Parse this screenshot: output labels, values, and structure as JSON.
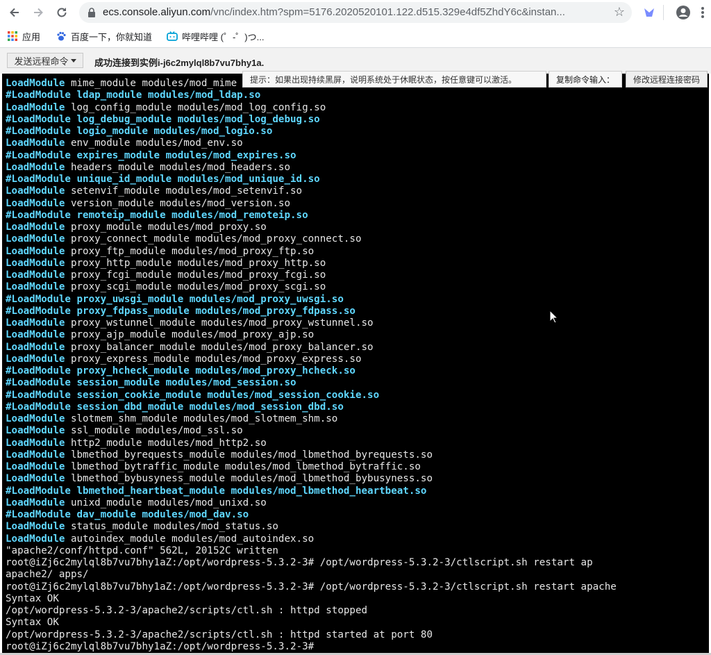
{
  "browser": {
    "url_host": "ecs.console.aliyun.com",
    "url_path": "/vnc/index.htm?spm=5176.2020520101.122.d515.329e4df5ZhdY6c&instan...",
    "bookmarks": [
      {
        "label": "应用",
        "icon": "apps-grid-icon"
      },
      {
        "label": "百度一下，你就知道",
        "icon": "baidu-paw-icon"
      },
      {
        "label": "哔哩哔哩 (゜-゜)つ...",
        "icon": "bilibili-tv-icon"
      }
    ]
  },
  "vnc": {
    "send_command_label": "发送远程命令",
    "status_text": "成功连接到实例i-j6c2mylql8b7vu7bhy1a.",
    "tip_text": "提示：如果出现持续黑屏，说明系统处于休眠状态，按任意键可以激活。",
    "copy_command_label": "复制命令输入：",
    "modify_password_label": "修改远程连接密码"
  },
  "terminal": {
    "lines": [
      {
        "text": "LoadModule mime_module modules/mod_mime",
        "style": "white-cyan"
      },
      {
        "text": "#LoadModule ldap_module modules/mod_ldap.so",
        "style": "cyan"
      },
      {
        "text": "LoadModule log_config_module modules/mod_log_config.so",
        "style": "white-cyan"
      },
      {
        "text": "#LoadModule log_debug_module modules/mod_log_debug.so",
        "style": "cyan"
      },
      {
        "text": "#LoadModule logio_module modules/mod_logio.so",
        "style": "cyan"
      },
      {
        "text": "LoadModule env_module modules/mod_env.so",
        "style": "white-cyan"
      },
      {
        "text": "#LoadModule expires_module modules/mod_expires.so",
        "style": "cyan"
      },
      {
        "text": "LoadModule headers_module modules/mod_headers.so",
        "style": "white-cyan"
      },
      {
        "text": "#LoadModule unique_id_module modules/mod_unique_id.so",
        "style": "cyan"
      },
      {
        "text": "LoadModule setenvif_module modules/mod_setenvif.so",
        "style": "white-cyan"
      },
      {
        "text": "LoadModule version_module modules/mod_version.so",
        "style": "white-cyan"
      },
      {
        "text": "#LoadModule remoteip_module modules/mod_remoteip.so",
        "style": "cyan"
      },
      {
        "text": "LoadModule proxy_module modules/mod_proxy.so",
        "style": "white-cyan"
      },
      {
        "text": "LoadModule proxy_connect_module modules/mod_proxy_connect.so",
        "style": "white-cyan"
      },
      {
        "text": "LoadModule proxy_ftp_module modules/mod_proxy_ftp.so",
        "style": "white-cyan"
      },
      {
        "text": "LoadModule proxy_http_module modules/mod_proxy_http.so",
        "style": "white-cyan"
      },
      {
        "text": "LoadModule proxy_fcgi_module modules/mod_proxy_fcgi.so",
        "style": "white-cyan"
      },
      {
        "text": "LoadModule proxy_scgi_module modules/mod_proxy_scgi.so",
        "style": "white-cyan"
      },
      {
        "text": "#LoadModule proxy_uwsgi_module modules/mod_proxy_uwsgi.so",
        "style": "cyan"
      },
      {
        "text": "#LoadModule proxy_fdpass_module modules/mod_proxy_fdpass.so",
        "style": "cyan"
      },
      {
        "text": "LoadModule proxy_wstunnel_module modules/mod_proxy_wstunnel.so",
        "style": "white-cyan"
      },
      {
        "text": "LoadModule proxy_ajp_module modules/mod_proxy_ajp.so",
        "style": "white-cyan"
      },
      {
        "text": "LoadModule proxy_balancer_module modules/mod_proxy_balancer.so",
        "style": "white-cyan"
      },
      {
        "text": "LoadModule proxy_express_module modules/mod_proxy_express.so",
        "style": "white-cyan"
      },
      {
        "text": "#LoadModule proxy_hcheck_module modules/mod_proxy_hcheck.so",
        "style": "cyan"
      },
      {
        "text": "#LoadModule session_module modules/mod_session.so",
        "style": "cyan"
      },
      {
        "text": "#LoadModule session_cookie_module modules/mod_session_cookie.so",
        "style": "cyan"
      },
      {
        "text": "#LoadModule session_dbd_module modules/mod_session_dbd.so",
        "style": "cyan"
      },
      {
        "text": "LoadModule slotmem_shm_module modules/mod_slotmem_shm.so",
        "style": "white-cyan"
      },
      {
        "text": "LoadModule ssl_module modules/mod_ssl.so",
        "style": "white-cyan"
      },
      {
        "text": "LoadModule http2_module modules/mod_http2.so",
        "style": "white-cyan"
      },
      {
        "text": "LoadModule lbmethod_byrequests_module modules/mod_lbmethod_byrequests.so",
        "style": "white-cyan"
      },
      {
        "text": "LoadModule lbmethod_bytraffic_module modules/mod_lbmethod_bytraffic.so",
        "style": "white-cyan"
      },
      {
        "text": "LoadModule lbmethod_bybusyness_module modules/mod_lbmethod_bybusyness.so",
        "style": "white-cyan"
      },
      {
        "text": "#LoadModule lbmethod_heartbeat_module modules/mod_lbmethod_heartbeat.so",
        "style": "cyan"
      },
      {
        "text": "LoadModule unixd_module modules/mod_unixd.so",
        "style": "white-cyan"
      },
      {
        "text": "#LoadModule dav_module modules/mod_dav.so",
        "style": "cyan"
      },
      {
        "text": "LoadModule status_module modules/mod_status.so",
        "style": "white-cyan"
      },
      {
        "text": "LoadModule autoindex_module modules/mod_autoindex.so",
        "style": "white-cyan"
      },
      {
        "text": "\"apache2/conf/httpd.conf\" 562L, 20152C written",
        "style": "white"
      },
      {
        "text": "root@iZj6c2mylql8b7vu7bhy1aZ:/opt/wordpress-5.3.2-3# /opt/wordpress-5.3.2-3/ctlscript.sh restart ap",
        "style": "white"
      },
      {
        "text": "apache2/ apps/",
        "style": "white"
      },
      {
        "text": "root@iZj6c2mylql8b7vu7bhy1aZ:/opt/wordpress-5.3.2-3# /opt/wordpress-5.3.2-3/ctlscript.sh restart apache",
        "style": "white"
      },
      {
        "text": "Syntax OK",
        "style": "white"
      },
      {
        "text": "/opt/wordpress-5.3.2-3/apache2/scripts/ctl.sh : httpd stopped",
        "style": "white"
      },
      {
        "text": "Syntax OK",
        "style": "white"
      },
      {
        "text": "/opt/wordpress-5.3.2-3/apache2/scripts/ctl.sh : httpd started at port 80",
        "style": "white"
      },
      {
        "text": "root@iZj6c2mylql8b7vu7bhy1aZ:/opt/wordpress-5.3.2-3#",
        "style": "white"
      }
    ]
  },
  "colors": {
    "terminal_bg": "#000000",
    "terminal_cyan": "#5fd7ff",
    "terminal_white": "#e6e6e6"
  }
}
